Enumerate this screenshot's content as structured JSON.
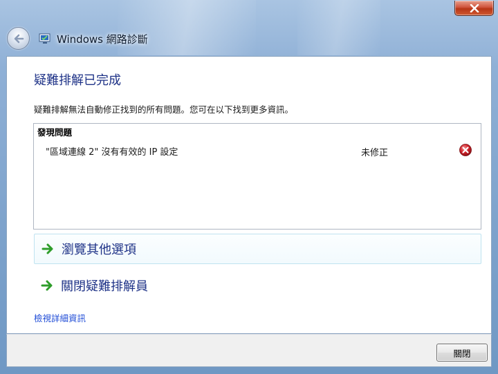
{
  "window": {
    "title": "Windows 網路診斷",
    "close_icon": "close-x-icon",
    "back_icon": "back-arrow-icon",
    "app_icon": "network-diagnostics-icon"
  },
  "main": {
    "heading": "疑難排解已完成",
    "description": "疑難排解無法自動修正找到的所有問題。您可在以下找到更多資訊。",
    "problems": {
      "header": "發現問題",
      "items": [
        {
          "name": "\"區域連線 2\" 沒有有效的 IP 設定",
          "status": "未修正",
          "status_icon": "error-icon"
        }
      ]
    },
    "options": [
      {
        "label": "瀏覽其他選項",
        "icon": "green-arrow-icon"
      },
      {
        "label": "關閉疑難排解員",
        "icon": "green-arrow-icon"
      }
    ],
    "details_link": "檢視詳細資訊"
  },
  "footer": {
    "close_button": "關閉"
  },
  "colors": {
    "heading": "#1e3287",
    "link": "#1e4bd6",
    "error": "#c8202a",
    "arrow": "#2e9d2a"
  }
}
